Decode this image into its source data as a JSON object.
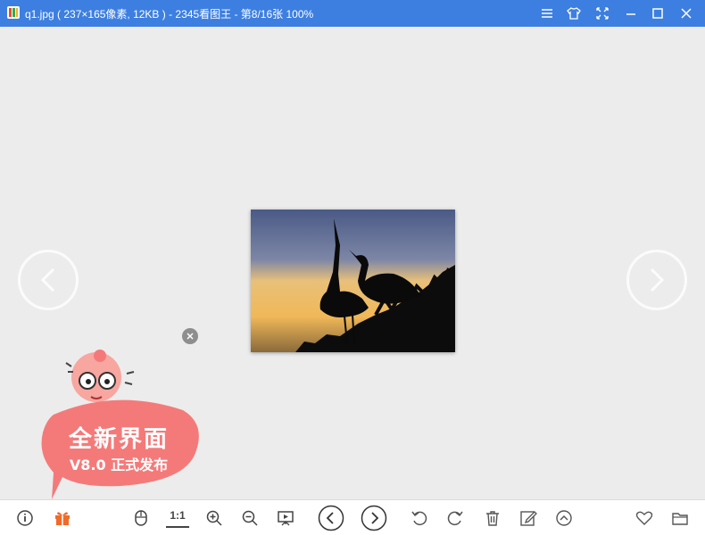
{
  "window": {
    "title": "q1.jpg ( 237×165像素, 12KB ) - 2345看图王 - 第8/16张 100%",
    "buttons": [
      "menu-icon",
      "skin-icon",
      "fullscreen-icon",
      "minimize-icon",
      "maximize-icon",
      "close-icon"
    ]
  },
  "viewer": {
    "image": "q1.jpg",
    "zoom": "100%",
    "position": "8/16"
  },
  "promo": {
    "line1": "全新界面",
    "line2": "V8.0 正式发布"
  },
  "toolbar": {
    "actual_size_label": "1:1",
    "icons": [
      "info-icon",
      "gift-icon",
      "mouse-icon",
      "actual-size",
      "zoom-in-icon",
      "zoom-out-icon",
      "slideshow-icon",
      "previous-icon",
      "next-icon",
      "rotate-left-icon",
      "rotate-right-icon",
      "delete-icon",
      "edit-icon",
      "more-icon",
      "favorite-icon",
      "folder-icon"
    ]
  },
  "colors": {
    "titlebar": "#3d7fe0",
    "viewer_bg": "#ececec",
    "promo_pink": "#f47a7a",
    "gift_orange": "#f06a2a"
  }
}
